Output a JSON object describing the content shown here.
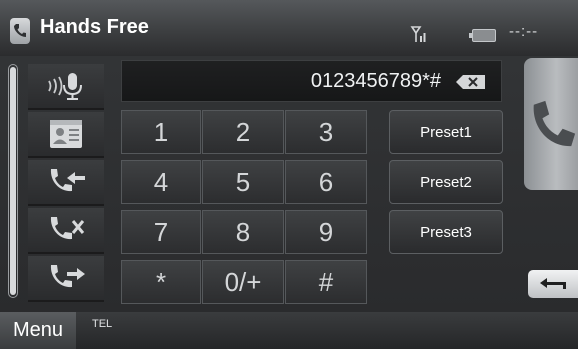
{
  "header": {
    "title": "Hands Free",
    "signal_icon": "signal-strength-icon",
    "battery_icon": "battery-icon",
    "time": "--:--"
  },
  "side_menu": {
    "items": [
      {
        "name": "voice-dial",
        "icon": "voice-microphone-icon"
      },
      {
        "name": "phonebook",
        "icon": "contact-card-icon"
      },
      {
        "name": "incoming-calls",
        "icon": "incoming-call-icon"
      },
      {
        "name": "missed-calls",
        "icon": "missed-call-icon"
      },
      {
        "name": "outgoing-calls",
        "icon": "outgoing-call-icon"
      }
    ]
  },
  "dial": {
    "number": "0123456789*#",
    "backspace_icon": "backspace-icon"
  },
  "keypad": {
    "keys": [
      "1",
      "2",
      "3",
      "4",
      "5",
      "6",
      "7",
      "8",
      "9",
      "*",
      "0/+",
      "#"
    ]
  },
  "presets": [
    "Preset1",
    "Preset2",
    "Preset3"
  ],
  "actions": {
    "call_icon": "phone-handset-icon",
    "return_icon": "return-arrow-icon"
  },
  "footer": {
    "menu_label": "Menu",
    "source_label": "TEL"
  },
  "colors": {
    "background": "#2e2f30",
    "accent": "#ffffff",
    "key_text": "#d4d6d8"
  }
}
